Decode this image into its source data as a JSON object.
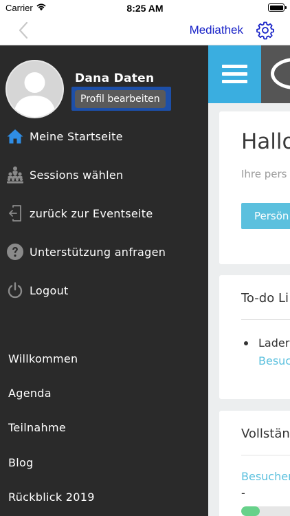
{
  "status_bar": {
    "carrier": "Carrier",
    "time": "8:25 AM"
  },
  "nav": {
    "title": "Mediathek",
    "back_icon": "chevron-left-icon",
    "settings_icon": "gear-icon",
    "accent": "#1a24c8"
  },
  "drawer": {
    "user_name": "Dana Daten",
    "edit_profile_label": "Profil bearbeiten",
    "menu": [
      {
        "label": "Meine Startseite",
        "icon": "home-icon"
      },
      {
        "label": "Sessions wählen",
        "icon": "audience-icon"
      },
      {
        "label": "zurück zur Eventseite",
        "icon": "exit-icon"
      },
      {
        "label": "Unterstützung anfragen",
        "icon": "help-icon"
      },
      {
        "label": "Logout",
        "icon": "power-icon"
      }
    ],
    "links": [
      "Willkommen",
      "Agenda",
      "Teilnahme",
      "Blog",
      "Rückblick 2019"
    ]
  },
  "content": {
    "greeting_card": {
      "title": "Hallo",
      "subtitle": "Ihre pers",
      "button_label": "Persön"
    },
    "todo_card": {
      "title": "To-do Li",
      "item_text": "Lader",
      "item_link": "Besuc"
    },
    "complete_card": {
      "title": "Vollstän",
      "link": "Besucher",
      "value": "-",
      "progress": 0.3
    }
  },
  "colors": {
    "drawer_bg": "#2a2a2a",
    "primary": "#3aaee0",
    "link": "#5bc0de",
    "progress": "#67d18a"
  }
}
